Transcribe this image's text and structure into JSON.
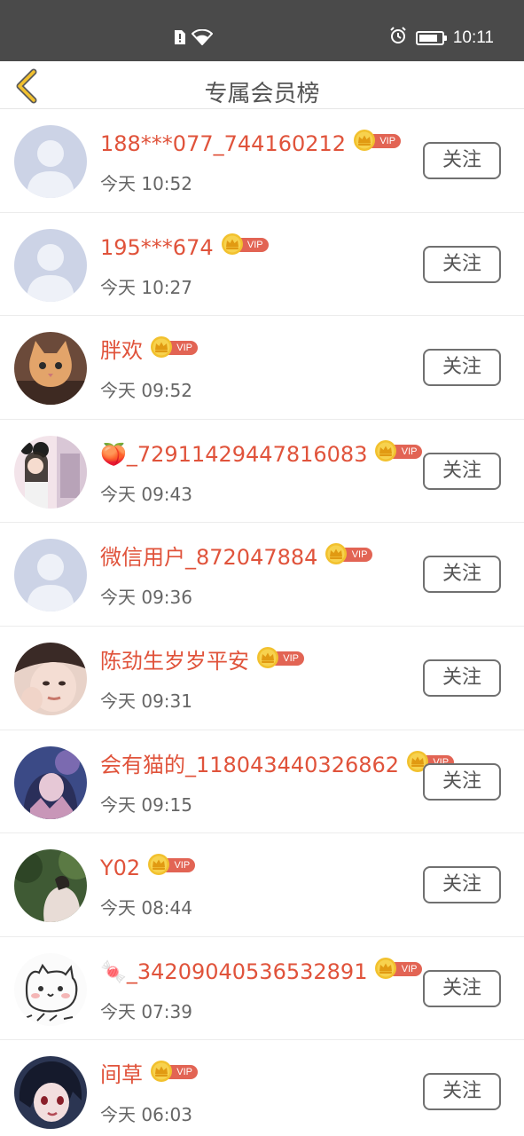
{
  "status_bar": {
    "time": "10:11",
    "battery_level": 0.85
  },
  "header": {
    "title": "专属会员榜"
  },
  "vip_label": "VIP",
  "colors": {
    "name": "#e0533b",
    "vip_badge": "#e26454",
    "crown": "#f2c12e"
  },
  "members": [
    {
      "name": "188***077_744160212",
      "time": "今天 10:52",
      "follow_label": "关注",
      "avatar": "default-avatar"
    },
    {
      "name": "195***674",
      "time": "今天 10:27",
      "follow_label": "关注",
      "avatar": "default-avatar"
    },
    {
      "name": "胖欢",
      "time": "今天 09:52",
      "follow_label": "关注",
      "avatar": "cat-photo"
    },
    {
      "name": "🍑_729114294478​16083",
      "time": "今天 09:43",
      "follow_label": "关注",
      "avatar": "girl-photo"
    },
    {
      "name": "微信用户_872047884",
      "time": "今天 09:36",
      "follow_label": "关注",
      "avatar": "default-avatar"
    },
    {
      "name": "陈劲生岁岁平安",
      "time": "今天 09:31",
      "follow_label": "关注",
      "avatar": "face-photo"
    },
    {
      "name": "会有猫的_118043440326862",
      "time": "今天 09:15",
      "follow_label": "关注",
      "avatar": "illustration-photo"
    },
    {
      "name": "Y02",
      "time": "今天 08:44",
      "follow_label": "关注",
      "avatar": "nature-photo"
    },
    {
      "name": "🍬_342090405365328​91",
      "time": "今天 07:39",
      "follow_label": "关注",
      "avatar": "cartoon-sketch"
    },
    {
      "name": "间草",
      "time": "今天 06:03",
      "follow_label": "关注",
      "avatar": "anime-photo"
    }
  ]
}
